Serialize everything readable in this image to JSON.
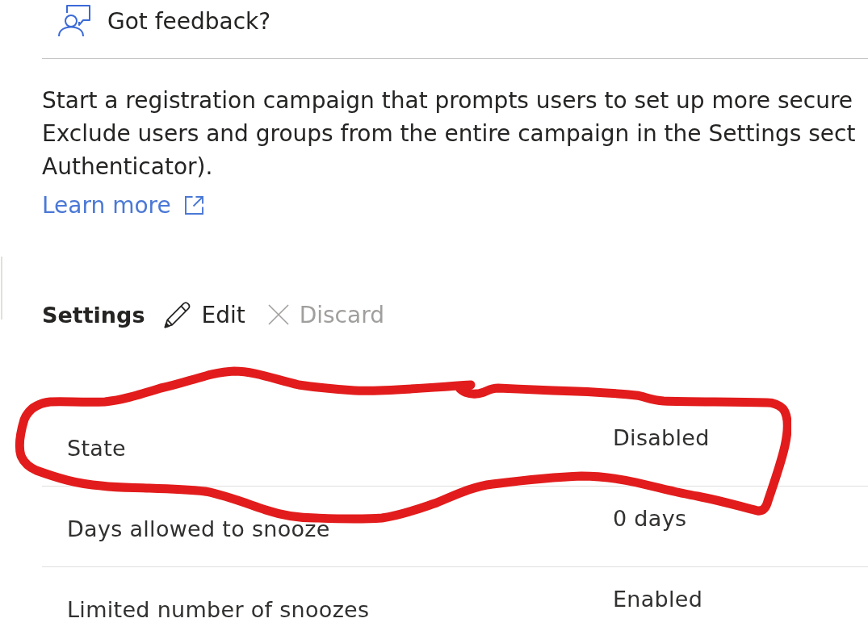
{
  "feedback": {
    "label": "Got feedback?"
  },
  "description": {
    "lines": [
      "Start a registration campaign that prompts users to set up more secure",
      "Exclude users and groups from the entire campaign in the Settings sect",
      "Authenticator)."
    ]
  },
  "learn_more": {
    "label": "Learn more"
  },
  "settings": {
    "title": "Settings",
    "actions": [
      {
        "kind": "edit",
        "label": "Edit",
        "disabled": false
      },
      {
        "kind": "discard",
        "label": "Discard",
        "disabled": true
      }
    ]
  },
  "rows": [
    {
      "label": "State",
      "value": "Disabled",
      "highlighted": true
    },
    {
      "label": "Days allowed to snooze",
      "value": "0 days",
      "highlighted": false
    },
    {
      "label": "Limited number of snoozes",
      "value": "Enabled",
      "highlighted": false
    }
  ]
}
